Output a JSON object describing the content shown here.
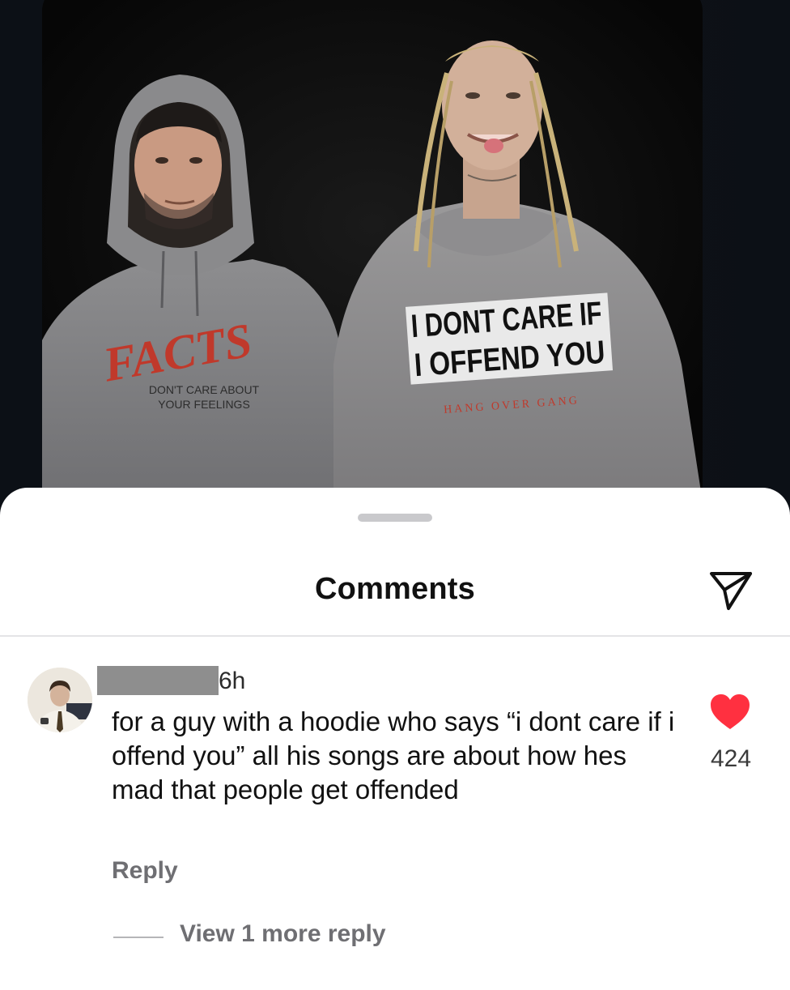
{
  "media": {
    "left_hoodie_logo": "FACTS",
    "left_hoodie_line1": "DON'T CARE ABOUT",
    "left_hoodie_line2": "YOUR FEELINGS",
    "right_hoodie_line1": "I DONT CARE IF",
    "right_hoodie_line2": "I OFFEND YOU",
    "right_hoodie_sub": "HANG OVER GANG"
  },
  "sheet": {
    "title": "Comments",
    "share_icon": "send-paper-plane-icon"
  },
  "comment": {
    "timestamp": "6h",
    "text": "for a guy with a hoodie who says “i dont care if i offend you” all his songs are about how hes mad that people get offended",
    "like_icon": "heart-filled-icon",
    "like_color": "#ff3040",
    "like_count": "424",
    "reply_label": "Reply",
    "view_replies_label": "View 1 more reply"
  }
}
